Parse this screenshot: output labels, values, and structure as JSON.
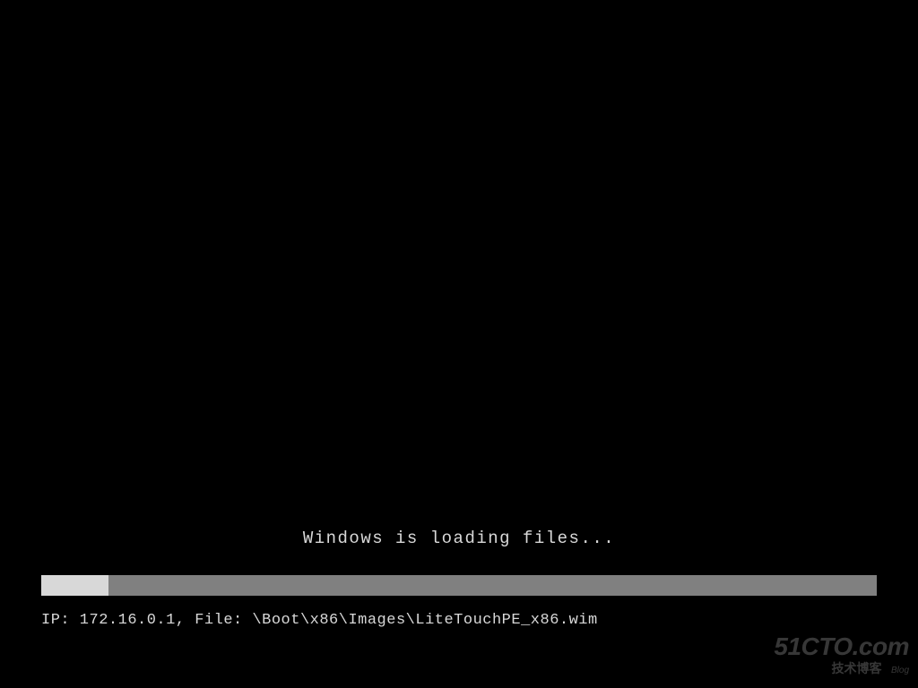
{
  "loading": {
    "message": "Windows is loading files...",
    "progress_percent": 8
  },
  "status": {
    "ip": "172.16.0.1",
    "file": "\\Boot\\x86\\Images\\LiteTouchPE_x86.wim",
    "full_line": "IP: 172.16.0.1, File: \\Boot\\x86\\Images\\LiteTouchPE_x86.wim"
  },
  "watermark": {
    "main": "51CTO.com",
    "sub": "技术博客",
    "tag": "Blog"
  }
}
